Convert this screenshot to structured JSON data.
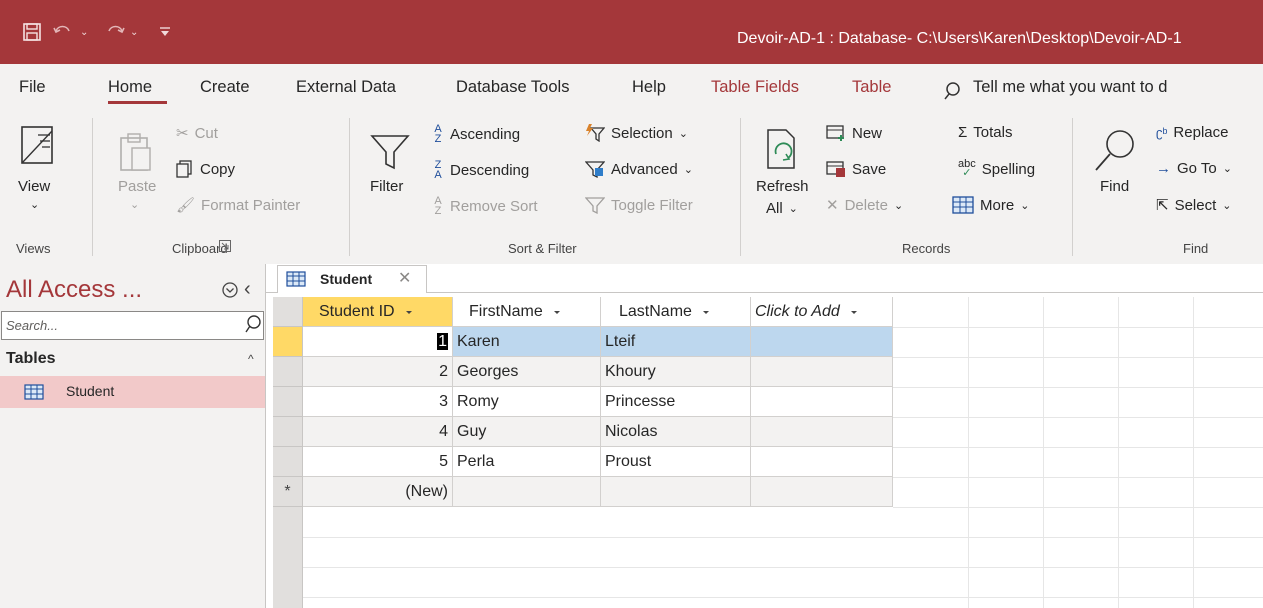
{
  "titlebar": {
    "title": "Devoir-AD-1 : Database- C:\\Users\\Karen\\Desktop\\Devoir-AD-1"
  },
  "tabs": {
    "file": "File",
    "home": "Home",
    "create": "Create",
    "external_data": "External Data",
    "database_tools": "Database Tools",
    "help": "Help",
    "table_fields": "Table Fields",
    "table": "Table",
    "tell_me": "Tell me what you want to d"
  },
  "ribbon": {
    "views": {
      "view": "View",
      "group": "Views"
    },
    "clipboard": {
      "paste": "Paste",
      "cut": "Cut",
      "copy": "Copy",
      "format_painter": "Format Painter",
      "group": "Clipboard"
    },
    "sort_filter": {
      "filter": "Filter",
      "ascending": "Ascending",
      "descending": "Descending",
      "remove_sort": "Remove Sort",
      "selection": "Selection",
      "advanced": "Advanced",
      "toggle_filter": "Toggle Filter",
      "group": "Sort & Filter"
    },
    "records": {
      "refresh": "Refresh",
      "all": "All",
      "new": "New",
      "save": "Save",
      "delete": "Delete",
      "totals": "Totals",
      "spelling": "Spelling",
      "more": "More",
      "group": "Records"
    },
    "find": {
      "find": "Find",
      "replace": "Replace",
      "go_to": "Go To",
      "select": "Select",
      "group": "Find"
    }
  },
  "nav": {
    "title": "All Access ...",
    "search_placeholder": "Search...",
    "section": "Tables",
    "items": [
      {
        "label": "Student"
      }
    ]
  },
  "document": {
    "tab_label": "Student"
  },
  "table": {
    "columns": [
      "Student ID",
      "FirstName",
      "LastName",
      "Click to Add"
    ],
    "rows": [
      {
        "id": "1",
        "first": "Karen",
        "last": "Lteif"
      },
      {
        "id": "2",
        "first": "Georges",
        "last": "Khoury"
      },
      {
        "id": "3",
        "first": "Romy",
        "last": "Princesse"
      },
      {
        "id": "4",
        "first": "Guy",
        "last": "Nicolas"
      },
      {
        "id": "5",
        "first": "Perla",
        "last": "Proust"
      }
    ],
    "new_row_label": "(New)",
    "new_row_marker": "*"
  },
  "colors": {
    "accent": "#a4373a",
    "selected_row": "#bdd7ee",
    "current_header": "#ffd966",
    "nav_selected": "#f2c9c9"
  }
}
